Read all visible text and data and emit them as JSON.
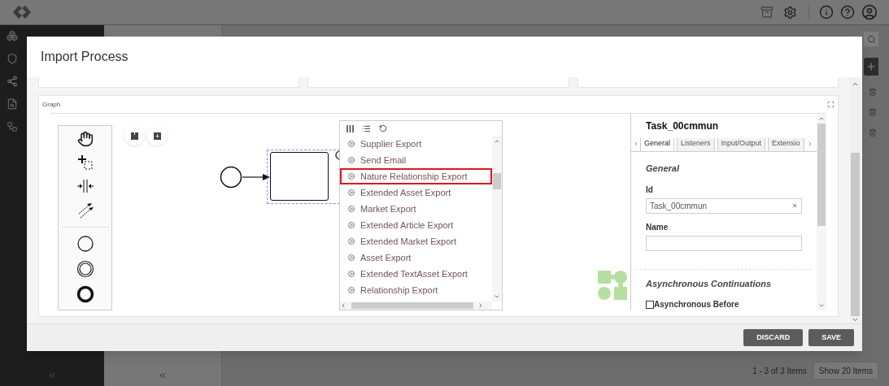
{
  "background": {
    "pager": "1 - 3 of 3 Items",
    "page_size_button": "Show 20 Items"
  },
  "dialog": {
    "title": "Import Process",
    "graph": {
      "label": "Graph",
      "service_tasks": [
        {
          "label": "Supplier Export",
          "highlighted": false
        },
        {
          "label": "Send Email",
          "highlighted": false
        },
        {
          "label": "Nature Relationship Export",
          "highlighted": true
        },
        {
          "label": "Extended Asset Export",
          "highlighted": false
        },
        {
          "label": "Market Export",
          "highlighted": false
        },
        {
          "label": "Extended Article Export",
          "highlighted": false
        },
        {
          "label": "Extended Market Export",
          "highlighted": false
        },
        {
          "label": "Asset Export",
          "highlighted": false
        },
        {
          "label": "Extended TextAsset Export",
          "highlighted": false
        },
        {
          "label": "Relationship Export",
          "highlighted": false
        }
      ],
      "properties": {
        "title": "Task_00cmmun",
        "tabs": [
          {
            "label": "General",
            "selected": true
          },
          {
            "label": "Listeners",
            "selected": false
          },
          {
            "label": "Input/Output",
            "selected": false
          },
          {
            "label": "Extensio",
            "selected": false
          }
        ],
        "section": "General",
        "id_label": "Id",
        "id_value": "Task_00cmmun",
        "name_label": "Name",
        "async_heading": "Asynchronous Continuations",
        "async_before": {
          "label": "Asynchronous Before",
          "checked": false
        }
      }
    },
    "buttons": [
      "DISCARD",
      "SAVE"
    ]
  }
}
